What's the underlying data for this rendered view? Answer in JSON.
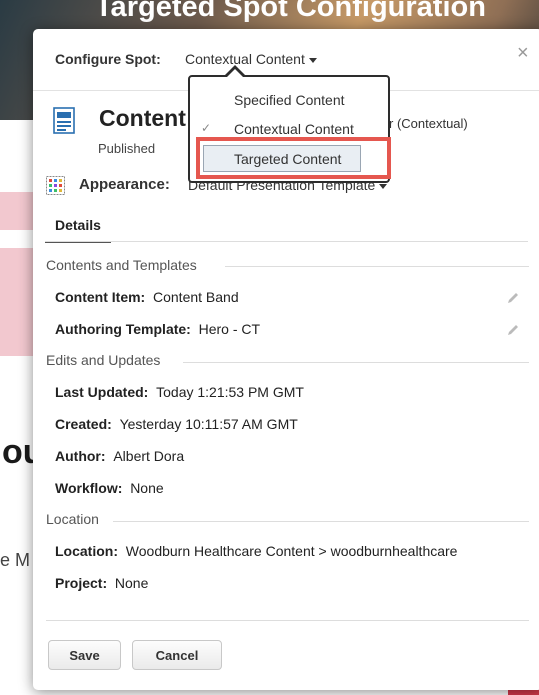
{
  "background": {
    "title": "Targeted Spot Configuration",
    "partial_heading": "ou",
    "partial_text": "e M"
  },
  "modal": {
    "configure_label": "Configure Spot:",
    "configure_value": "Contextual Content",
    "close_label": "×",
    "content_title": "Content Band",
    "contextual_tag": "r (Contextual)",
    "status": "Published",
    "appearance_label": "Appearance:",
    "appearance_value": "Default Presentation Template",
    "tab_details": "Details"
  },
  "sections": {
    "contents_templates": "Contents and Templates",
    "edits_updates": "Edits and Updates",
    "location": "Location"
  },
  "fields": {
    "content_item_label": "Content Item:",
    "content_item_value": "Content Band",
    "authoring_template_label": "Authoring Template:",
    "authoring_template_value": "Hero - CT",
    "last_updated_label": "Last Updated:",
    "last_updated_value": "Today 1:21:53 PM GMT",
    "created_label": "Created:",
    "created_value": "Yesterday 10:11:57 AM GMT",
    "author_label": "Author:",
    "author_value": "Albert Dora",
    "workflow_label": "Workflow:",
    "workflow_value": "None",
    "location_label": "Location:",
    "location_value": "Woodburn Healthcare Content > woodburnhealthcare",
    "project_label": "Project:",
    "project_value": "None"
  },
  "buttons": {
    "save": "Save",
    "cancel": "Cancel"
  },
  "dropdown": {
    "items": [
      {
        "label": "Specified Content",
        "checked": false
      },
      {
        "label": "Contextual Content",
        "checked": true
      },
      {
        "label": "Targeted Content",
        "checked": false,
        "highlighted": true
      }
    ],
    "check_glyph": "✓"
  },
  "colors": {
    "highlight_border": "#e5574f",
    "dropdown_border": "#2d2d2d"
  }
}
